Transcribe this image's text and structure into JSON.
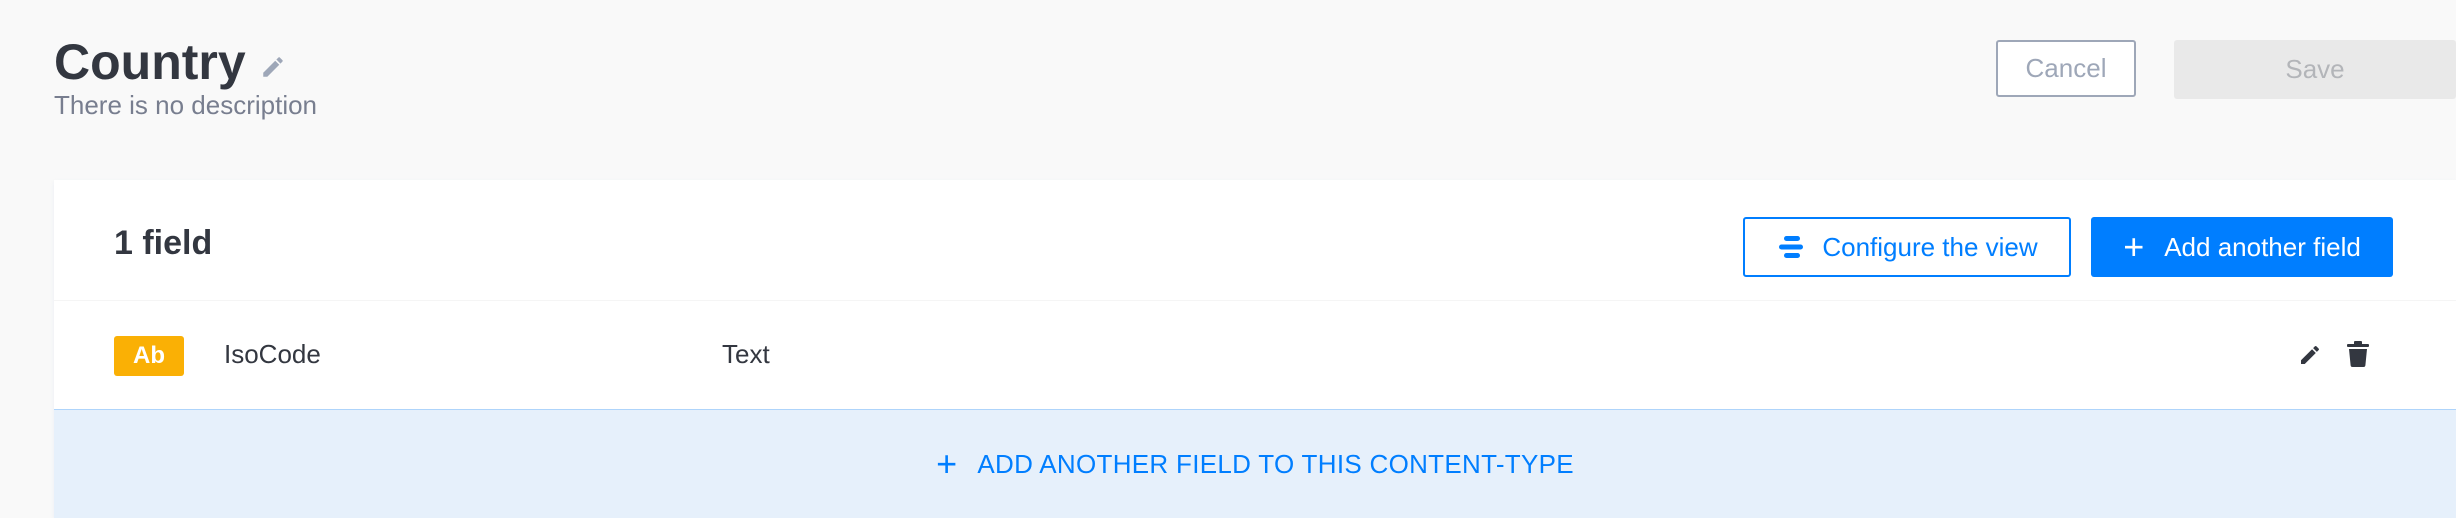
{
  "header": {
    "title": "Country",
    "description": "There is no description",
    "cancel_label": "Cancel",
    "save_label": "Save"
  },
  "card": {
    "field_count_label": "1 field",
    "configure_label": "Configure the view",
    "add_field_label": "Add another field",
    "add_field_icon": "plus-icon",
    "configure_icon": "layout-icon"
  },
  "fields": [
    {
      "badge": "Ab",
      "name": "IsoCode",
      "type": "Text",
      "edit_icon": "pencil-icon",
      "delete_icon": "trash-icon"
    }
  ],
  "footer": {
    "add_to_content_type_label": "ADD ANOTHER FIELD TO THIS CONTENT-TYPE"
  },
  "colors": {
    "primary": "#007eff",
    "badge_text": "#fab005",
    "add_bar_bg": "#e6f0fb",
    "disabled_bg": "#e9e9e9"
  }
}
